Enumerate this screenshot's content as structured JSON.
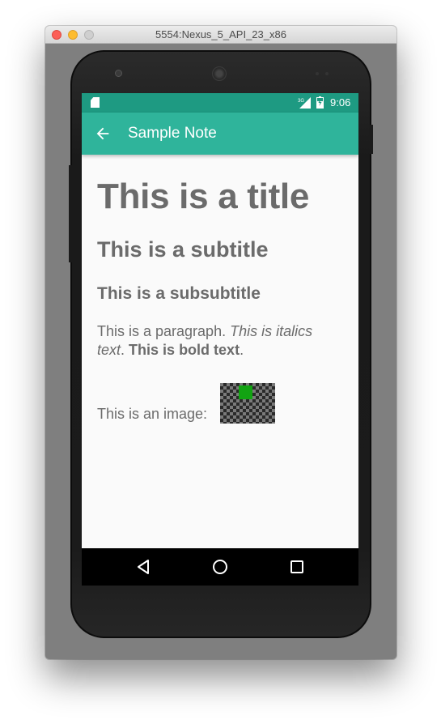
{
  "window": {
    "title": "5554:Nexus_5_API_23_x86"
  },
  "status_bar": {
    "network": "3G",
    "time": "9:06"
  },
  "app_bar": {
    "title": "Sample Note"
  },
  "note": {
    "title": "This is a title",
    "subtitle": "This is a subtitle",
    "subsubtitle": "This is a subsubtitle",
    "paragraph": {
      "plain": "This is a paragraph.",
      "italic": "This is italics text",
      "sep": ".",
      "bold": "This is bold text",
      "end": "."
    },
    "image_label": "This is an image:"
  },
  "colors": {
    "status_bar": "#1e9a82",
    "app_bar": "#2fb49b",
    "text": "#6b6b6b",
    "image_square": "#12a312"
  },
  "icons": {
    "back": "arrow-back-icon",
    "sd_card": "sd-card-icon",
    "signal": "signal-icon",
    "battery": "battery-charging-icon",
    "nav_back": "nav-back-icon",
    "nav_home": "nav-home-icon",
    "nav_recents": "nav-recents-icon"
  }
}
